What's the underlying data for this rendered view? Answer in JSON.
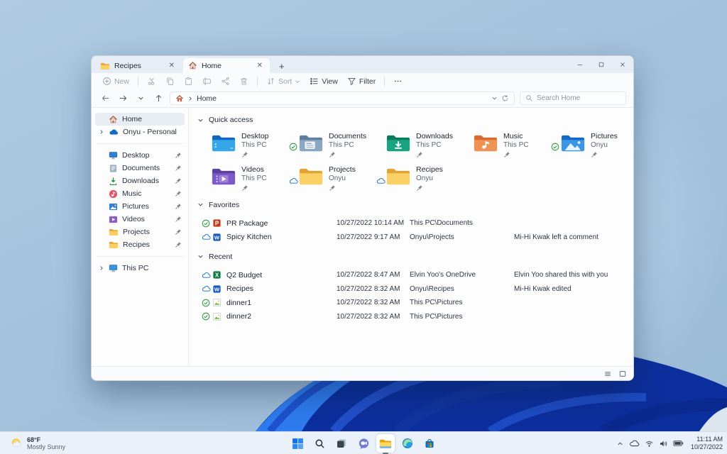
{
  "window": {
    "tabs": [
      {
        "label": "Recipes",
        "icon": "folder-icon",
        "active": false
      },
      {
        "label": "Home",
        "icon": "home-icon",
        "active": true
      }
    ],
    "toolbar": {
      "new_label": "New",
      "sort_label": "Sort",
      "view_label": "View",
      "filter_label": "Filter",
      "more_label": "…",
      "disabled_icons": [
        "cut-icon",
        "copy-icon",
        "paste-icon",
        "rename-icon",
        "share-icon",
        "delete-icon"
      ]
    },
    "address": {
      "breadcrumb": "Home",
      "icon": "home-icon"
    },
    "search": {
      "placeholder": "Search Home"
    },
    "sidebar": {
      "groups": [
        {
          "items": [
            {
              "label": "Home",
              "icon": "home",
              "selected": true,
              "expandable": false,
              "pinned": false
            },
            {
              "label": "Onyu - Personal",
              "icon": "onedrive",
              "selected": false,
              "expandable": true,
              "pinned": false
            }
          ]
        },
        {
          "items": [
            {
              "label": "Desktop",
              "icon": "desktop",
              "pinned": true
            },
            {
              "label": "Documents",
              "icon": "documents",
              "pinned": true
            },
            {
              "label": "Downloads",
              "icon": "downloads",
              "pinned": true
            },
            {
              "label": "Music",
              "icon": "music",
              "pinned": true
            },
            {
              "label": "Pictures",
              "icon": "pictures",
              "pinned": true
            },
            {
              "label": "Videos",
              "icon": "videos",
              "pinned": true
            },
            {
              "label": "Projects",
              "icon": "folder",
              "pinned": true
            },
            {
              "label": "Recipes",
              "icon": "folder",
              "pinned": true
            }
          ]
        },
        {
          "items": [
            {
              "label": "This PC",
              "icon": "thispc",
              "expandable": true,
              "pinned": false
            }
          ]
        }
      ]
    },
    "quick_access": {
      "title": "Quick access",
      "tiles": [
        {
          "name": "Desktop",
          "location": "This PC",
          "icon": "qa-desktop",
          "badge": "",
          "pinned": true
        },
        {
          "name": "Documents",
          "location": "This PC",
          "icon": "qa-documents",
          "badge": "synced",
          "pinned": true
        },
        {
          "name": "Downloads",
          "location": "This PC",
          "icon": "qa-downloads",
          "badge": "",
          "pinned": true
        },
        {
          "name": "Music",
          "location": "This PC",
          "icon": "qa-music",
          "badge": "",
          "pinned": true
        },
        {
          "name": "Pictures",
          "location": "Onyu",
          "icon": "qa-pictures",
          "badge": "synced",
          "pinned": true
        },
        {
          "name": "Videos",
          "location": "This PC",
          "icon": "qa-videos",
          "badge": "",
          "pinned": true
        },
        {
          "name": "Projects",
          "location": "Onyu",
          "icon": "qa-folder",
          "badge": "cloud",
          "pinned": true
        },
        {
          "name": "Recipes",
          "location": "Onyu",
          "icon": "qa-folder",
          "badge": "cloud",
          "pinned": true
        }
      ]
    },
    "favorites": {
      "title": "Favorites",
      "rows": [
        {
          "status": "synced",
          "file_icon": "powerpoint",
          "name": "PR Package",
          "date": "10/27/2022 10:14 AM",
          "location": "This PC\\Documents",
          "note": ""
        },
        {
          "status": "cloud",
          "file_icon": "word",
          "name": "Spicy Kitchen",
          "date": "10/27/2022 9:17 AM",
          "location": "Onyu\\Projects",
          "note": "Mi-Hi Kwak left a comment"
        }
      ]
    },
    "recent": {
      "title": "Recent",
      "rows": [
        {
          "status": "cloud",
          "file_icon": "excel",
          "name": "Q2 Budget",
          "date": "10/27/2022 8:47 AM",
          "location": "Elvin Yoo's OneDrive",
          "note": "Elvin Yoo shared this with you"
        },
        {
          "status": "cloud",
          "file_icon": "word",
          "name": "Recipes",
          "date": "10/27/2022 8:32 AM",
          "location": "Onyu\\Recipes",
          "note": "Mi-Hi Kwak edited"
        },
        {
          "status": "synced",
          "file_icon": "image",
          "name": "dinner1",
          "date": "10/27/2022 8:32 AM",
          "location": "This PC\\Pictures",
          "note": ""
        },
        {
          "status": "synced",
          "file_icon": "image",
          "name": "dinner2",
          "date": "10/27/2022 8:32 AM",
          "location": "This PC\\Pictures",
          "note": ""
        }
      ]
    }
  },
  "taskbar": {
    "weather": {
      "temp": "68°F",
      "condition": "Mostly Sunny",
      "icon": "sun-cloud-icon"
    },
    "apps": [
      {
        "name": "start",
        "active": false
      },
      {
        "name": "search",
        "active": false
      },
      {
        "name": "task-view",
        "active": false
      },
      {
        "name": "chat",
        "active": false
      },
      {
        "name": "file-explorer",
        "active": true
      },
      {
        "name": "edge",
        "active": false
      },
      {
        "name": "store",
        "active": false
      }
    ],
    "tray": {
      "icons": [
        "chevron-up",
        "cloud-tray",
        "wifi",
        "volume",
        "battery"
      ],
      "time": "11:11 AM",
      "date": "10/27/2022"
    }
  },
  "colors": {
    "accent_blue": "#0b2fa0",
    "folder_yellow": "#fbd064",
    "sync_green": "#2e9b3e",
    "cloud_blue": "#0f6cc4"
  }
}
